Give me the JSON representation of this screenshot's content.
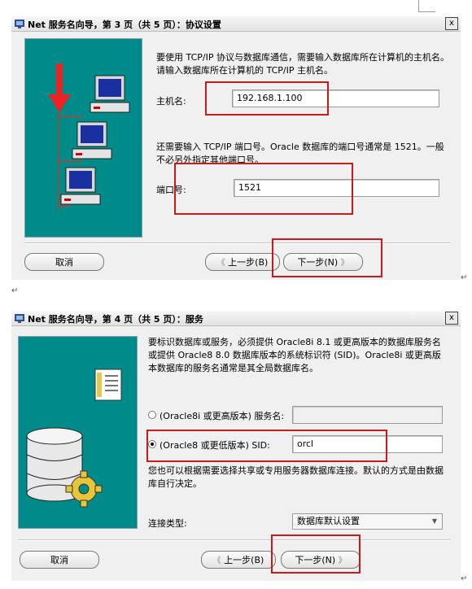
{
  "panel1": {
    "title": "Net 服务名向导，第 3 页（共 5 页）：协议设置",
    "close": "x",
    "intro": "要使用 TCP/IP 协议与数据库通信，需要输入数据库所在计算机的主机名。请输入数据库所在计算机的 TCP/IP 主机名。",
    "host_label": "主机名:",
    "host_value": "192.168.1.100",
    "port_intro": "还需要输入 TCP/IP 端口号。Oracle 数据库的端口号通常是 1521。一般不必另外指定其他端口号。",
    "port_label": "端口号:",
    "port_value": "1521",
    "cancel": "取消",
    "back": "上一步(B)",
    "next": "下一步(N)",
    "back_arrow": "《",
    "next_arrow": "》"
  },
  "panel2": {
    "title": "Net 服务名向导，第 4 页（共 5 页）：服务",
    "close": "x",
    "intro": "要标识数据库或服务，必须提供 Oracle8i 8.1 或更高版本的数据库服务名或提供 Oracle8 8.0 数据库版本的系统标识符 (SID)。Oracle8i 或更高版本数据库的服务名通常是其全局数据库名。",
    "radio1_label": "(Oracle8i 或更高版本) 服务名:",
    "radio1_value": "",
    "radio2_label": "(Oracle8 或更低版本) SID:",
    "radio2_value": "orcl",
    "connection_note": "您也可以根据需要选择共享或专用服务器数据库连接。默认的方式是由数据库自行决定。",
    "conn_type_label": "连接类型:",
    "conn_type_value": "数据库默认设置",
    "cancel": "取消",
    "back": "上一步(B)",
    "next": "下一步(N)",
    "back_arrow": "《",
    "next_arrow": "》"
  },
  "marks": {
    "paragraph": "↵"
  }
}
